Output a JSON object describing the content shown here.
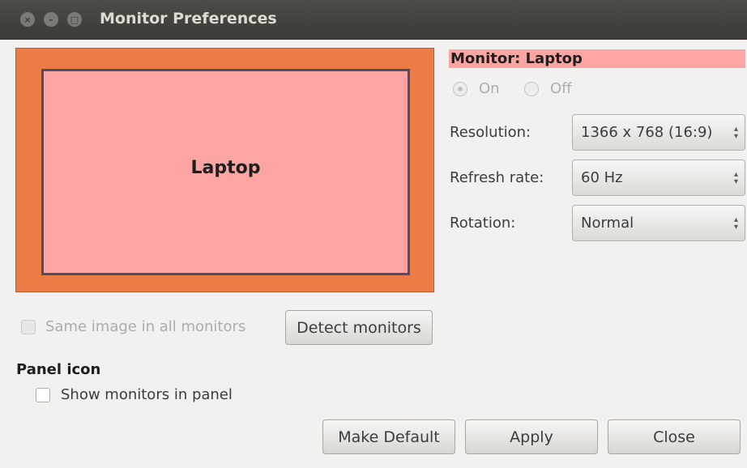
{
  "window": {
    "title": "Monitor Preferences",
    "close_glyph": "×",
    "minimize_glyph": "–",
    "maximize_glyph": "□"
  },
  "preview": {
    "monitor_label": "Laptop",
    "bg_color": "#ec7c46",
    "monitor_color": "#fca5a3"
  },
  "monitor": {
    "header": "Monitor: Laptop",
    "on_label": "On",
    "off_label": "Off",
    "selected": "On"
  },
  "settings": {
    "resolution_label": "Resolution:",
    "resolution_value": "1366 x 768 (16:9)",
    "refresh_label": "Refresh rate:",
    "refresh_value": "60 Hz",
    "rotation_label": "Rotation:",
    "rotation_value": "Normal"
  },
  "mirror": {
    "label": "Same image in all monitors",
    "checked": false,
    "enabled": false
  },
  "detect_button": "Detect monitors",
  "panel": {
    "title": "Panel icon",
    "show_label": "Show monitors in panel",
    "checked": false
  },
  "buttons": {
    "make_default": "Make Default",
    "apply": "Apply",
    "close": "Close"
  }
}
